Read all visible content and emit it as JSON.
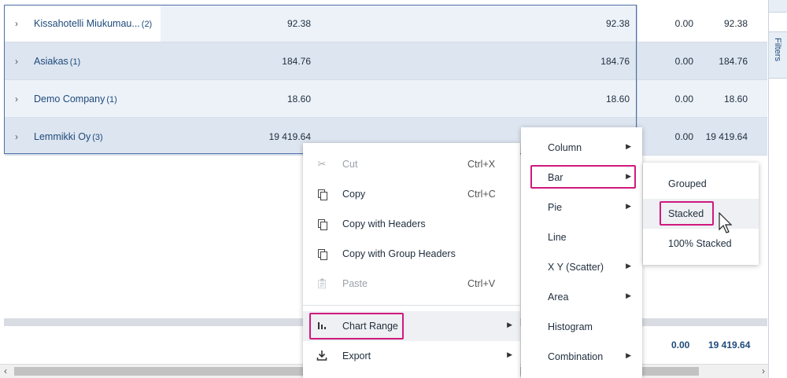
{
  "groups": [
    {
      "name": "Kissahotelli Miukumau...",
      "count": "(2)",
      "v1": "92.38",
      "v2": "92.38",
      "v3": "0.00",
      "v4": "92.38"
    },
    {
      "name": "Asiakas",
      "count": "(1)",
      "v1": "184.76",
      "v2": "184.76",
      "v3": "0.00",
      "v4": "184.76"
    },
    {
      "name": "Demo Company",
      "count": "(1)",
      "v1": "18.60",
      "v2": "18.60",
      "v3": "0.00",
      "v4": "18.60"
    },
    {
      "name": "Lemmikki Oy",
      "count": "(3)",
      "v1": "19 419.64",
      "v2": "",
      "v3": "0.00",
      "v4": "19 419.64"
    }
  ],
  "totals": {
    "t1": "0.00",
    "t2": "19 419.64"
  },
  "sidebar": {
    "filters_label": "Filters"
  },
  "context_menu": {
    "items": [
      {
        "label": "Cut",
        "shortcut": "Ctrl+X",
        "icon": "scissors-icon",
        "disabled": true
      },
      {
        "label": "Copy",
        "shortcut": "Ctrl+C",
        "icon": "copy-icon"
      },
      {
        "label": "Copy with Headers",
        "icon": "copy-icon"
      },
      {
        "label": "Copy with Group Headers",
        "icon": "copy-icon"
      },
      {
        "label": "Paste",
        "shortcut": "Ctrl+V",
        "icon": "clipboard-icon",
        "disabled": true
      },
      {
        "label": "Chart Range",
        "icon": "bar-chart-icon",
        "submenu": true
      },
      {
        "label": "Export",
        "icon": "download-icon",
        "submenu": true
      }
    ]
  },
  "chart_menu": {
    "items": [
      {
        "label": "Column",
        "submenu": true
      },
      {
        "label": "Bar",
        "submenu": true
      },
      {
        "label": "Pie",
        "submenu": true
      },
      {
        "label": "Line"
      },
      {
        "label": "X Y (Scatter)",
        "submenu": true
      },
      {
        "label": "Area",
        "submenu": true
      },
      {
        "label": "Histogram"
      },
      {
        "label": "Combination",
        "submenu": true
      }
    ]
  },
  "bar_menu": {
    "items": [
      {
        "label": "Grouped"
      },
      {
        "label": "Stacked"
      },
      {
        "label": "100% Stacked"
      }
    ]
  },
  "colors": {
    "highlight": "#d0197e",
    "group_text": "#1e4a7a"
  }
}
